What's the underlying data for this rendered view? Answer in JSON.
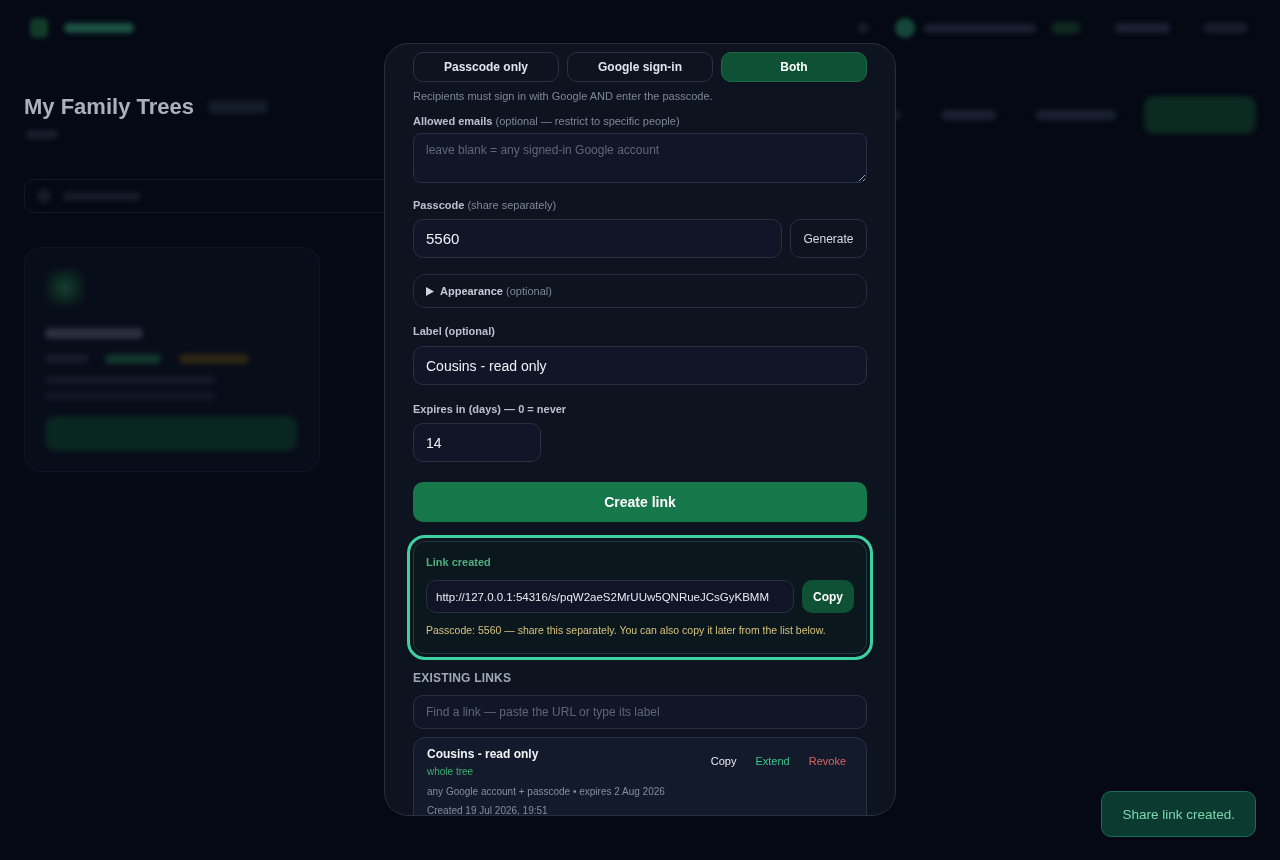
{
  "background_page": {
    "title": "My Family Trees"
  },
  "dialog": {
    "access_modes": [
      {
        "label": "Passcode only",
        "selected": false
      },
      {
        "label": "Google sign-in",
        "selected": false
      },
      {
        "label": "Both",
        "selected": true
      }
    ],
    "access_hint": "Recipients must sign in with Google AND enter the passcode.",
    "allowed_emails": {
      "label": "**Allowed emails** (optional — restrict to specific people)",
      "placeholder": "leave blank = any signed-in Google account"
    },
    "passcode": {
      "label": "**Passcode** (share separately)",
      "value": "5560",
      "generate_button": "Generate"
    },
    "appearance": {
      "label": "**Appearance** (optional)",
      "expanded": false
    },
    "link_label": {
      "label": "Label (optional)",
      "value": "Cousins - read only"
    },
    "expires": {
      "label": "Expires in (days) — 0 = never",
      "value": "14"
    },
    "create_button": "Create link",
    "created_link": {
      "title": "Link created",
      "url": "http://127.0.0.1:54316/s/pqW2aeS2MrUUw5QNRueJCsGyKBMM",
      "copy_button": "Copy",
      "note": "Passcode: 5560 — share this separately. You can also copy it later from the list below."
    },
    "existing_links": {
      "heading": "EXISTING LINKS",
      "search_placeholder": "Find a link — paste the URL or type its label",
      "items": [
        {
          "label": "Cousins - read only",
          "scope": "whole tree",
          "details": "any Google account + passcode • expires 2 Aug 2026",
          "created": "Created 19 Jul 2026, 19:51",
          "actions": [
            {
              "label": "Copy",
              "kind": "copy"
            },
            {
              "label": "Extend",
              "kind": "extend"
            },
            {
              "label": "Revoke",
              "kind": "revoke"
            }
          ]
        }
      ]
    }
  },
  "toast": "Share link created."
}
